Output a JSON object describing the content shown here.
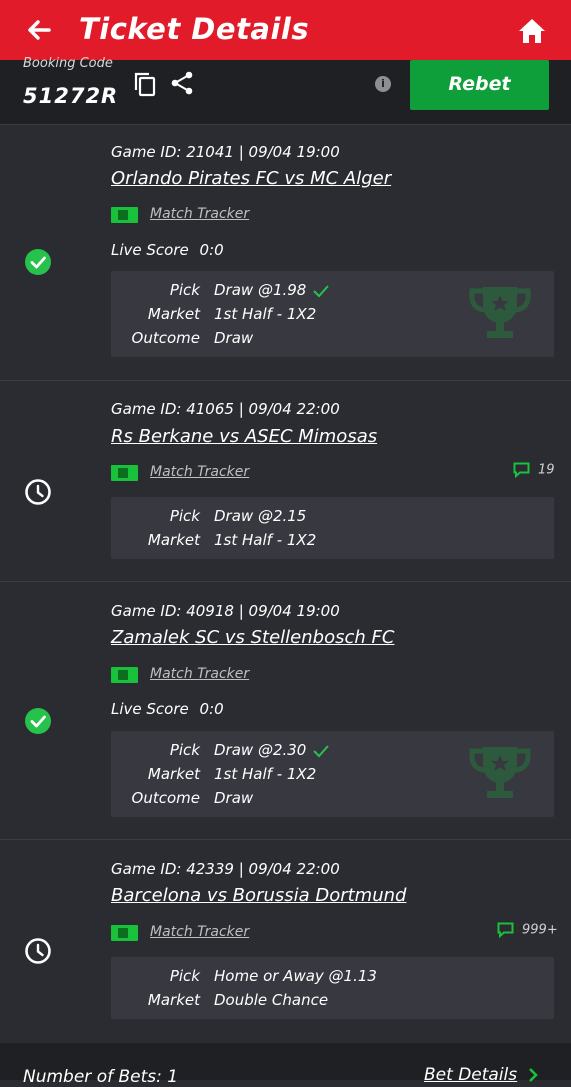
{
  "header": {
    "title": "Ticket Details"
  },
  "booking": {
    "label": "Booking Code",
    "code": "51272R",
    "rebet_label": "Rebet"
  },
  "labels": {
    "pick": "Pick",
    "market": "Market",
    "outcome": "Outcome",
    "live_score": "Live Score",
    "match_tracker": "Match Tracker"
  },
  "bets": [
    {
      "game_line": "Game ID: 21041 | 09/04 19:00",
      "teams": "Orlando Pirates FC vs MC Alger",
      "status": "won",
      "live_score": "0:0",
      "pick": "Draw @1.98",
      "market": "1st Half - 1X2",
      "outcome": "Draw",
      "comments": ""
    },
    {
      "game_line": "Game ID: 41065 | 09/04 22:00",
      "teams": "Rs Berkane vs ASEC Mimosas",
      "status": "pending",
      "pick": "Draw @2.15",
      "market": "1st Half - 1X2",
      "comments": "19"
    },
    {
      "game_line": "Game ID: 40918 | 09/04 19:00",
      "teams": "Zamalek SC vs Stellenbosch FC",
      "status": "won",
      "live_score": "0:0",
      "pick": "Draw @2.30",
      "market": "1st Half - 1X2",
      "outcome": "Draw",
      "comments": ""
    },
    {
      "game_line": "Game ID: 42339 | 09/04 22:00",
      "teams": "Barcelona vs Borussia Dortmund",
      "status": "pending",
      "pick": "Home or Away @1.13",
      "market": "Double Chance",
      "comments": "999+"
    }
  ],
  "footer": {
    "number_of_bets": "Number of Bets: 1",
    "bet_details": "Bet Details"
  },
  "colors": {
    "header_red": "#e11b2a",
    "rebet_green": "#0e9e3a",
    "won_green": "#27c24c",
    "tracker_green": "#18c23a"
  }
}
